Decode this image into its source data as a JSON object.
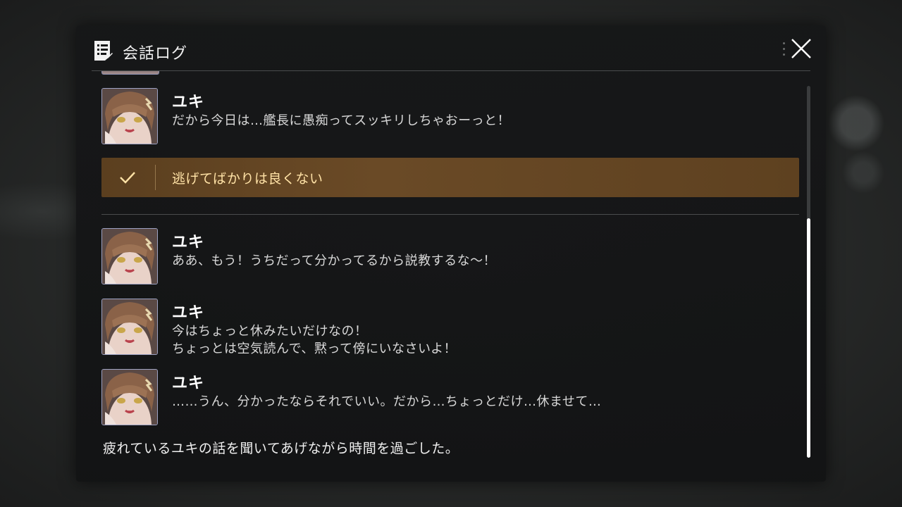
{
  "header": {
    "title": "会話ログ",
    "log_icon": "document-log-icon",
    "close_icon": "close-icon"
  },
  "log": {
    "cut_off_line": "・・・・・・・・・・・・・・・・・・・・・・・・・・・・",
    "entries_before_choice": [
      {
        "speaker": "ユキ",
        "lines": [
          "だから今日は…艦長に愚痴ってスッキリしちゃおーっと！"
        ]
      }
    ],
    "choice": {
      "icon": "checkmark-icon",
      "text": "逃げてばかりは良くない"
    },
    "entries_after_choice": [
      {
        "speaker": "ユキ",
        "lines": [
          "ああ、もう！うちだって分かってるから説教するな〜！"
        ]
      },
      {
        "speaker": "ユキ",
        "lines": [
          "今はちょっと休みたいだけなの！",
          "ちょっとは空気読んで、黙って傍にいなさいよ！"
        ]
      },
      {
        "speaker": "ユキ",
        "lines": [
          "……うん、分かったならそれでいい。だから…ちょっとだけ…休ませて…"
        ]
      }
    ],
    "narration": "疲れているユキの話を聞いてあげながら時間を過ごした。"
  },
  "colors": {
    "choice_bg": "#6a4a26",
    "choice_text": "#ffe2a6",
    "scroll_thumb": "#ffffff"
  }
}
